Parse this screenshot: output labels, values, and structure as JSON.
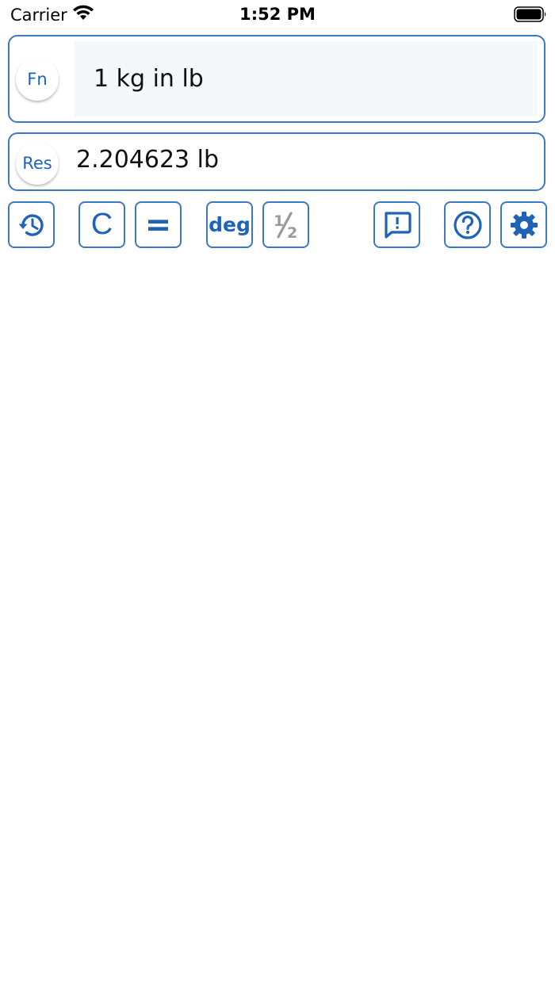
{
  "status_bar": {
    "carrier": "Carrier",
    "time": "1:52 PM"
  },
  "function_field": {
    "badge_label": "Fn",
    "value": "1 kg in lb"
  },
  "result_field": {
    "badge_label": "Res",
    "value": "2.204623 lb"
  },
  "toolbar": {
    "clear_label": "C",
    "equals_label": "=",
    "angle_mode_label": "deg"
  },
  "colors": {
    "accent": "#1f63b9",
    "border": "#3b79c2",
    "input_background": "#f5f8fb",
    "disabled": "#9a9a9a"
  },
  "icons": {
    "history": "history-icon",
    "fraction": "fraction-icon",
    "feedback": "feedback-icon",
    "help": "help-icon",
    "settings": "gear-icon"
  }
}
